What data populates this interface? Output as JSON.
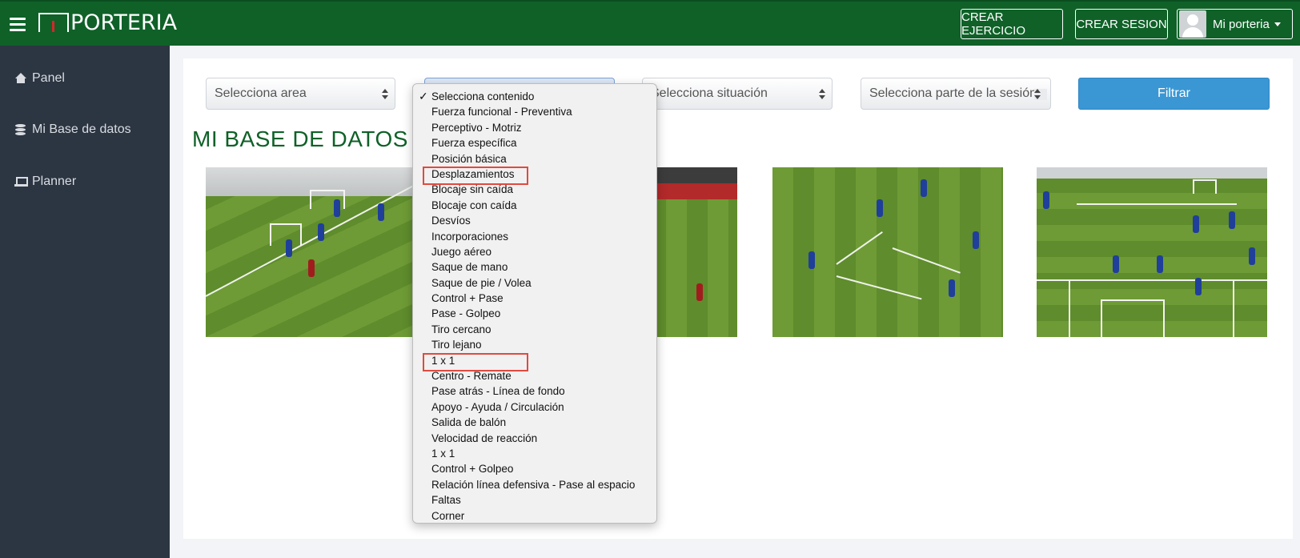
{
  "header": {
    "logo_text": "PORTERIA",
    "create_exercise_label": "CREAR EJERCICIO",
    "create_session_label": "CREAR SESION",
    "user_name": "Mi porteria"
  },
  "sidebar": {
    "items": [
      {
        "label": "Panel",
        "icon": "home-icon"
      },
      {
        "label": "Mi Base de datos",
        "icon": "database-icon"
      },
      {
        "label": "Planner",
        "icon": "laptop-icon"
      }
    ]
  },
  "filters": {
    "area_selected": "Selecciona area",
    "contenido_selected": "Selecciona contenido",
    "situacion_selected": "Selecciona situación",
    "parte_selected": "Selecciona parte de la sesión",
    "filter_button": "Filtrar"
  },
  "page_title": "MI BASE DE DATOS",
  "dropdown": {
    "options": [
      "Selecciona contenido",
      "Fuerza funcional - Preventiva",
      "Perceptivo - Motriz",
      "Fuerza específica",
      "Posición básica",
      "Desplazamientos",
      "Blocaje sin caída",
      "Blocaje con caída",
      "Desvíos",
      "Incorporaciones",
      "Juego aéreo",
      "Saque de mano",
      "Saque de pie / Volea",
      "Control + Pase",
      "Pase - Golpeo",
      "Tiro cercano",
      "Tiro lejano",
      "1 x 1",
      "Centro - Remate",
      "Pase atrás - Línea de fondo",
      "Apoyo - Ayuda / Circulación",
      "Salida de balón",
      "Velocidad de reacción",
      "1 x 1",
      "Control + Golpeo",
      "Relación línea defensiva - Pase al espacio",
      "Faltas",
      "Corner"
    ],
    "checked_index": 0,
    "highlighted_indices": [
      5,
      17
    ]
  },
  "colors": {
    "header_bg": "#0f6128",
    "sidebar_bg": "#2c3542",
    "accent_button": "#3a97d4",
    "title_color": "#0f6128",
    "highlight_box": "#e04a3f"
  }
}
